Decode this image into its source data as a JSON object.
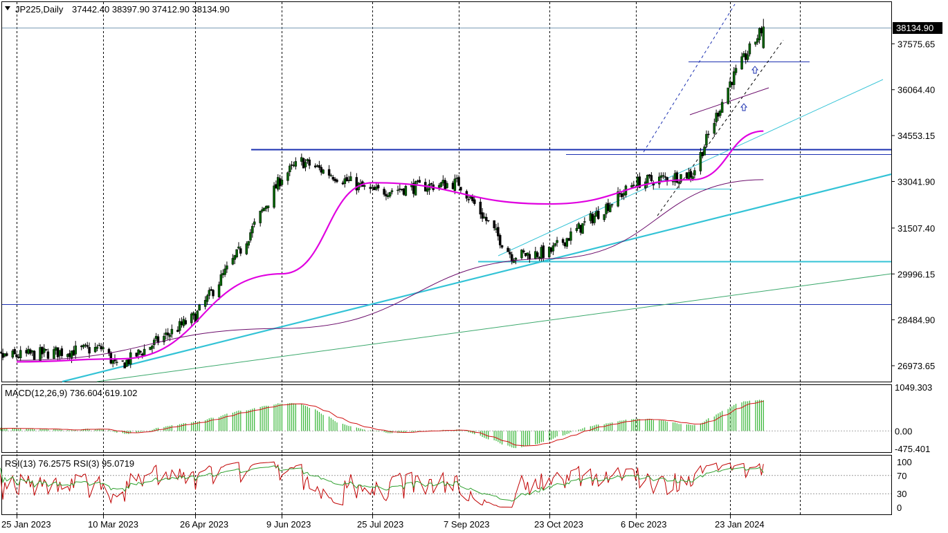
{
  "header": {
    "symbol": "JP225,Daily",
    "ohlc": "37442.40 38397.90 37412.90 38134.90",
    "collapse_icon": "triangle-down-icon"
  },
  "chart_data": {
    "type": "candlestick",
    "symbol": "JP225",
    "timeframe": "Daily",
    "last_price": "38134.90",
    "price_axis": {
      "ticks": [
        "37575.65",
        "36064.40",
        "34553.15",
        "33041.90",
        "31507.40",
        "29996.15",
        "28484.90",
        "26973.65"
      ],
      "range": [
        26450,
        38950
      ]
    },
    "time_axis": {
      "ticks": [
        "25 Jan 2023",
        "10 Mar 2023",
        "26 Apr 2023",
        "9 Jun 2023",
        "25 Jul 2023",
        "7 Sep 2023",
        "23 Oct 2023",
        "6 Dec 2023",
        "23 Jan 2024"
      ]
    },
    "key_closes": [
      [
        "25 Jan 2023",
        27300
      ],
      [
        "10 Mar 2023",
        27550
      ],
      [
        "17 Mar 2023",
        26900
      ],
      [
        "26 Apr 2023",
        28600
      ],
      [
        "19 May 2023",
        30800
      ],
      [
        "9 Jun 2023",
        33200
      ],
      [
        "19 Jun 2023",
        33700
      ],
      [
        "25 Jul 2023",
        32700
      ],
      [
        "7 Sep 2023",
        33000
      ],
      [
        "4 Oct 2023",
        30600
      ],
      [
        "23 Oct 2023",
        30700
      ],
      [
        "6 Dec 2023",
        33000
      ],
      [
        "4 Jan 2024",
        33300
      ],
      [
        "23 Jan 2024",
        36300
      ],
      [
        "9 Feb 2024",
        38134.9
      ]
    ],
    "moving_averages": [
      {
        "color": "#e000e0",
        "points": [
          [
            "25 Jan 2023",
            27100
          ],
          [
            "19 Mar 2023",
            27200
          ],
          [
            "9 Jun 2023",
            30000
          ],
          [
            "25 Jul 2023",
            33000
          ],
          [
            "23 Oct 2023",
            32300
          ],
          [
            "4 Jan 2024",
            33100
          ],
          [
            "9 Feb 2024",
            34700
          ]
        ]
      },
      {
        "color": "#6a0a6a",
        "points": [
          [
            "25 Jan 2023",
            27150
          ],
          [
            "9 Jun 2023",
            28200
          ],
          [
            "23 Oct 2023",
            30500
          ],
          [
            "9 Feb 2024",
            33100
          ]
        ]
      }
    ],
    "horizontal_levels": [
      {
        "price": 34100,
        "color": "#1a2fb0"
      },
      {
        "price": 33940,
        "color": "#1a2fb0"
      },
      {
        "price": 30420,
        "color": "#33c3d6"
      },
      {
        "price": 29000,
        "color": "#1a2fb0"
      },
      {
        "price": 37000,
        "color": "#1a2fb0"
      }
    ],
    "macd": {
      "label": "MACD(12,26,9) 736.604 619.102",
      "value": 736.604,
      "signal": 619.102,
      "ticks": [
        "1049.303",
        "0.00",
        "-475.401"
      ]
    },
    "rsi": {
      "label": "RSI(13) 76.2575 RSI(3) 95.0719",
      "rsi13": 76.2575,
      "rsi3": 95.0719,
      "ticks": [
        "100",
        "70",
        "30",
        "0"
      ]
    },
    "colors": {
      "candle_up": "#006400",
      "candle_down": "#000000",
      "ma_fast": "#e000e0",
      "ma_slow": "#6a0a6a",
      "trend_cyan": "#33c3d6",
      "trend_green": "#3aa86b",
      "level_blue": "#1a2fb0",
      "macd_hist": "#32b432",
      "macd_signal": "#d01010",
      "rsi_fast": "#c00000",
      "rsi_slow": "#2ea02e"
    }
  }
}
